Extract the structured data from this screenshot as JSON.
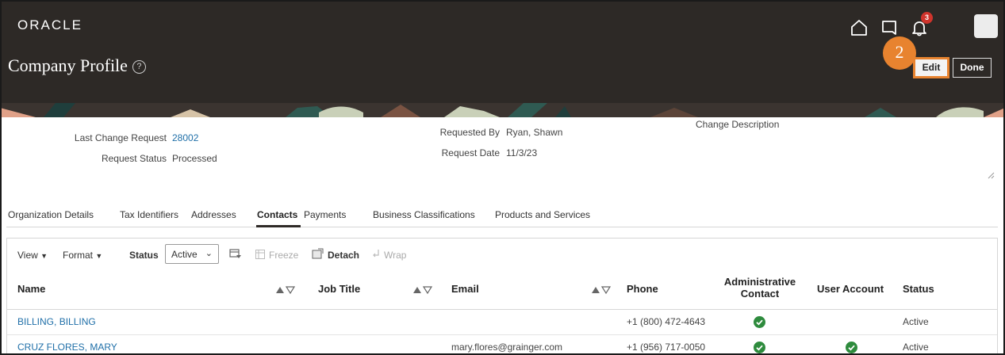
{
  "app": {
    "logo": "ORACLE",
    "page_title": "Company Profile",
    "help": "?"
  },
  "header": {
    "notifications_count": "3",
    "step_marker": "2",
    "edit_label": "Edit",
    "done_label": "Done"
  },
  "profile": {
    "last_change_request_label": "Last Change Request",
    "last_change_request_value": "28002",
    "request_status_label": "Request Status",
    "request_status_value": "Processed",
    "requested_by_label": "Requested By",
    "requested_by_value": "Ryan, Shawn",
    "request_date_label": "Request Date",
    "request_date_value": "11/3/23",
    "change_description_label": "Change Description"
  },
  "tabs": [
    {
      "label": "Organization Details"
    },
    {
      "label": "Tax Identifiers"
    },
    {
      "label": "Addresses"
    },
    {
      "label": "Contacts"
    },
    {
      "label": "Payments"
    },
    {
      "label": "Business Classifications"
    },
    {
      "label": "Products and Services"
    }
  ],
  "active_tab": "Contacts",
  "toolbar": {
    "view_label": "View",
    "format_label": "Format",
    "status_label": "Status",
    "status_value": "Active",
    "freeze_label": "Freeze",
    "detach_label": "Detach",
    "wrap_label": "Wrap"
  },
  "table": {
    "columns": {
      "name": "Name",
      "job_title": "Job Title",
      "email": "Email",
      "phone": "Phone",
      "admin_contact_1": "Administrative",
      "admin_contact_2": "Contact",
      "user_account": "User Account",
      "status": "Status"
    },
    "rows": [
      {
        "name": "BILLING, BILLING",
        "job_title": "",
        "email": "",
        "phone": "+1 (800) 472-4643",
        "admin_contact": true,
        "user_account": false,
        "status": "Active"
      },
      {
        "name": "CRUZ FLORES, MARY",
        "job_title": "",
        "email": "mary.flores@grainger.com",
        "phone": "+1 (956) 717-0050",
        "admin_contact": true,
        "user_account": true,
        "status": "Active"
      }
    ]
  },
  "colors": {
    "header_bg": "#2d2926",
    "link": "#1f6fa8",
    "check": "#2e8b3d",
    "highlight": "#e8832f",
    "badge": "#d0342c"
  }
}
